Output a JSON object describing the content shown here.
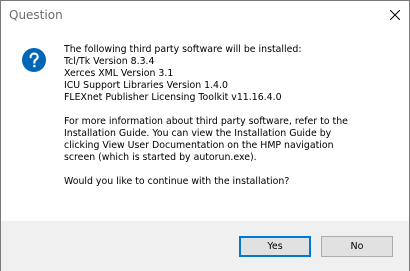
{
  "window": {
    "title": "Question"
  },
  "icons": {
    "info": "question-icon",
    "close": "close-icon"
  },
  "message": {
    "intro": "The following third party software will be installed:",
    "components": [
      "Tcl/Tk Version 8.3.4",
      "Xerces XML Version 3.1",
      "ICU Support Libraries Version 1.4.0",
      "FLEXnet Publisher Licensing Toolkit v11.16.4.0"
    ],
    "info_lines": [
      "For more information about third party software, refer to the",
      "Installation Guide.  You can view the Installation Guide by",
      "clicking View User Documentation on the HMP navigation",
      "screen (which is started by autorun.exe)."
    ],
    "question": "Would you like to continue with the installation?"
  },
  "buttons": {
    "yes_label": "Yes",
    "no_label": "No"
  },
  "colors": {
    "icon_blue": "#0067b8",
    "focus_border": "#0078d7",
    "footer_bg": "#f0f0f0",
    "button_bg": "#e1e1e1"
  }
}
